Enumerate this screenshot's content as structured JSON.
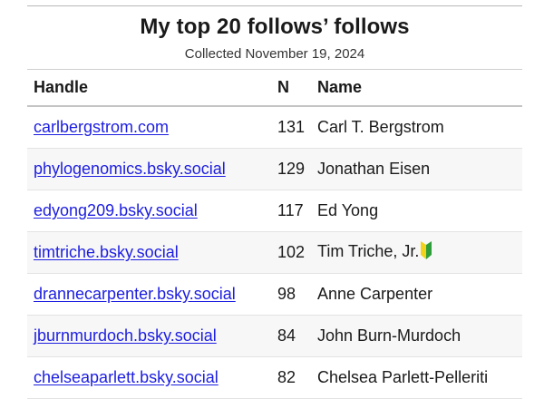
{
  "title": "My top 20 follows’ follows",
  "subtitle": "Collected November 19, 2024",
  "headers": {
    "handle": "Handle",
    "n": "N",
    "name": "Name"
  },
  "rows": [
    {
      "handle": "carlbergstrom.com",
      "n": "131",
      "name": "Carl T. Bergstrom",
      "icon": null
    },
    {
      "handle": "phylogenomics.bsky.social",
      "n": "129",
      "name": "Jonathan Eisen",
      "icon": null
    },
    {
      "handle": "edyong209.bsky.social",
      "n": "117",
      "name": "Ed Yong",
      "icon": null
    },
    {
      "handle": "timtriche.bsky.social",
      "n": "102",
      "name": "Tim Triche, Jr.",
      "icon": "japanese-beginner-symbol-icon"
    },
    {
      "handle": "drannecarpenter.bsky.social",
      "n": "98",
      "name": "Anne Carpenter",
      "icon": null
    },
    {
      "handle": "jburnmurdoch.bsky.social",
      "n": "84",
      "name": "John Burn-Murdoch",
      "icon": null
    },
    {
      "handle": "chelseaparlett.bsky.social",
      "n": "82",
      "name": "Chelsea Parlett-Pelleriti",
      "icon": null
    }
  ],
  "colors": {
    "link": "#1d1ee0",
    "stripe": "#f7f7f7",
    "badge_green": "#2e9e3a",
    "badge_yellow": "#f2d21b"
  }
}
